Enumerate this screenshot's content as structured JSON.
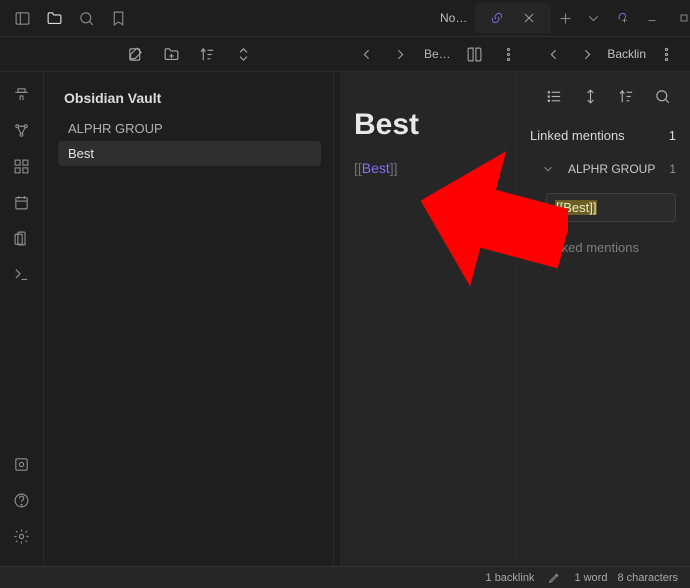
{
  "titlebar": {
    "tabs": [
      {
        "label": "No…"
      },
      {
        "label": ""
      }
    ]
  },
  "toolbar": {
    "editor_breadcrumb": "Be…",
    "backlink_breadcrumb": "Backlin"
  },
  "sidebar": {
    "vault_title": "Obsidian Vault",
    "items": [
      {
        "label": "ALPHR GROUP",
        "selected": false
      },
      {
        "label": "Best",
        "selected": true
      }
    ]
  },
  "editor": {
    "title": "Best",
    "link_open": "[[",
    "link_text": "Best",
    "link_close": "]]"
  },
  "backlinks": {
    "linked_label": "Linked mentions",
    "linked_count": "1",
    "group": {
      "name": "ALPHR GROUP",
      "count": "1"
    },
    "match_open": "[[",
    "match_text": "Best",
    "match_close": "]]",
    "unlinked_label": "Unlinked mentions"
  },
  "status": {
    "backlinks": "1 backlink",
    "words": "1 word",
    "chars": "8 characters"
  }
}
